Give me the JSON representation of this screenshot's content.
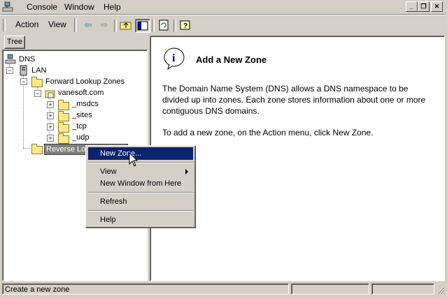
{
  "menubar": {
    "console": "Console",
    "window": "Window",
    "help": "Help"
  },
  "toolbar": {
    "action": "Action",
    "view": "View"
  },
  "tree": {
    "tab": "Tree",
    "nodes": {
      "dns": "DNS",
      "lan": "LAN",
      "forward": "Forward Lookup Zones",
      "vanesoft": "vanesoft.com",
      "msdcs": "_msdcs",
      "sites": "_sites",
      "tcp": "_tcp",
      "udp": "_udp",
      "reverse": "Reverse Lookup Zones"
    }
  },
  "content": {
    "heading": "Add a New Zone",
    "paragraph1": "The Domain Name System (DNS) allows a DNS namespace to be divided up into zones. Each zone stores information about one or more contiguous DNS domains.",
    "paragraph2": "To add a new zone, on the Action menu, click New Zone."
  },
  "context_menu": {
    "new_zone": "New Zone...",
    "view": "View",
    "new_window": "New Window from Here",
    "refresh": "Refresh",
    "help": "Help"
  },
  "statusbar": {
    "text": "Create a new zone"
  },
  "colors": {
    "selection": "#0a246a",
    "chrome": "#d4d0c8"
  }
}
